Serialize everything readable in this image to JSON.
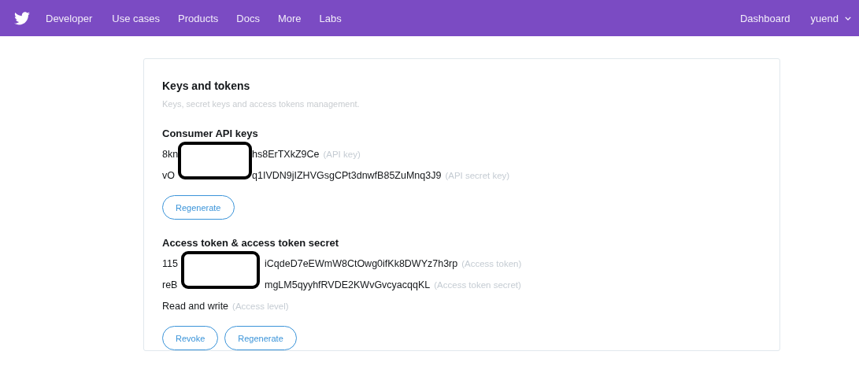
{
  "nav": {
    "brand": "Developer",
    "links": [
      "Use cases",
      "Products",
      "Docs",
      "More",
      "Labs"
    ],
    "right_links": [
      "Dashboard"
    ],
    "user": "yuend"
  },
  "card": {
    "title": "Keys and tokens",
    "subtitle": "Keys, secret keys and access tokens management.",
    "sections": [
      {
        "heading": "Consumer API keys",
        "redacted": true,
        "rows": [
          {
            "prefix": "8kn",
            "value": "hs8ErTXkZ9Ce",
            "note": "(API key)"
          },
          {
            "prefix": "vO",
            "value": "q1IVDN9jIZHVGsgCPt3dnwfB85ZuMnq3J9",
            "note": "(API secret key)"
          }
        ],
        "buttons": [
          "Regenerate"
        ]
      },
      {
        "heading": "Access token & access token secret",
        "redacted": true,
        "rows": [
          {
            "prefix": "115",
            "value": "iCqdeD7eEWmW8CtOwg0ifKk8DWYz7h3rp",
            "note": "(Access token)"
          },
          {
            "prefix": "reB",
            "value": "mgLM5qyyhfRVDE2KWvGvcyacqqKL",
            "note": "(Access token secret)"
          }
        ],
        "extra_rows": [
          {
            "value": "Read and write",
            "note": "(Access level)"
          }
        ],
        "buttons": [
          "Revoke",
          "Regenerate"
        ]
      }
    ]
  }
}
